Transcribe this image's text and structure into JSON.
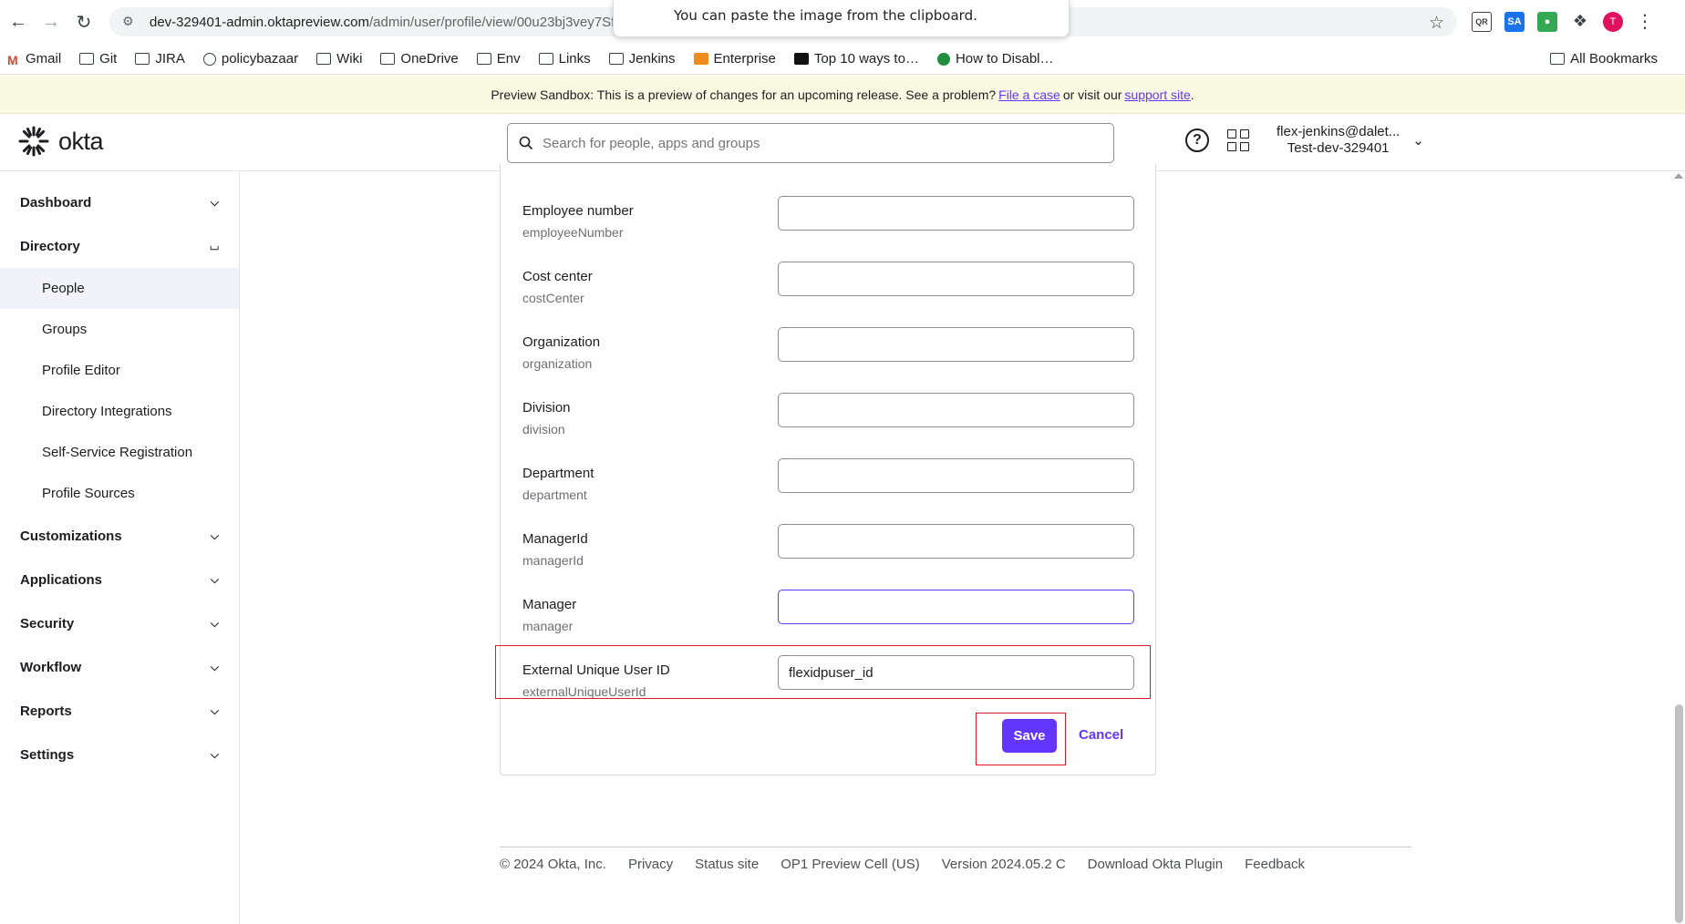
{
  "browser": {
    "url_host": "dev-329401-admin.oktapreview.com",
    "url_path": "/admin/user/profile/view/00u23bj3vey7SfyRE",
    "popup_text": "You can paste the image from the clipboard.",
    "avatar_letter": "T",
    "bookmarks": [
      "Gmail",
      "Git",
      "JIRA",
      "policybazaar",
      "Wiki",
      "OneDrive",
      "Env",
      "Links",
      "Jenkins",
      "Enterprise",
      "Top 10 ways to…",
      "How to Disabl…"
    ],
    "all_bookmarks": "All Bookmarks"
  },
  "banner": {
    "text_before": "Preview Sandbox: This is a preview of changes for an upcoming release. See a problem?",
    "file_case": "File a case",
    "text_middle": "or visit our",
    "support_site": "support site",
    "text_after": "."
  },
  "header": {
    "logo": "okta",
    "search_placeholder": "Search for people, apps and groups",
    "user_email": "flex-jenkins@dalet...",
    "org": "Test-dev-329401"
  },
  "sidebar": {
    "dashboard": "Dashboard",
    "directory": "Directory",
    "directory_items": [
      "People",
      "Groups",
      "Profile Editor",
      "Directory Integrations",
      "Self-Service Registration",
      "Profile Sources"
    ],
    "customizations": "Customizations",
    "applications": "Applications",
    "security": "Security",
    "workflow": "Workflow",
    "reports": "Reports",
    "settings": "Settings"
  },
  "form": {
    "fields": [
      {
        "label": "Employee number",
        "var": "employeeNumber",
        "value": ""
      },
      {
        "label": "Cost center",
        "var": "costCenter",
        "value": ""
      },
      {
        "label": "Organization",
        "var": "organization",
        "value": ""
      },
      {
        "label": "Division",
        "var": "division",
        "value": ""
      },
      {
        "label": "Department",
        "var": "department",
        "value": ""
      },
      {
        "label": "ManagerId",
        "var": "managerId",
        "value": ""
      },
      {
        "label": "Manager",
        "var": "manager",
        "value": ""
      },
      {
        "label": "External Unique User ID",
        "var": "externalUniqueUserId",
        "value": "flexidpuser_id"
      }
    ],
    "save": "Save",
    "cancel": "Cancel"
  },
  "footer": {
    "copyright": "© 2024 Okta, Inc.",
    "privacy": "Privacy",
    "status": "Status site",
    "cell": "OP1 Preview Cell (US)",
    "version": "Version 2024.05.2 C",
    "plugin": "Download Okta Plugin",
    "feedback": "Feedback"
  }
}
